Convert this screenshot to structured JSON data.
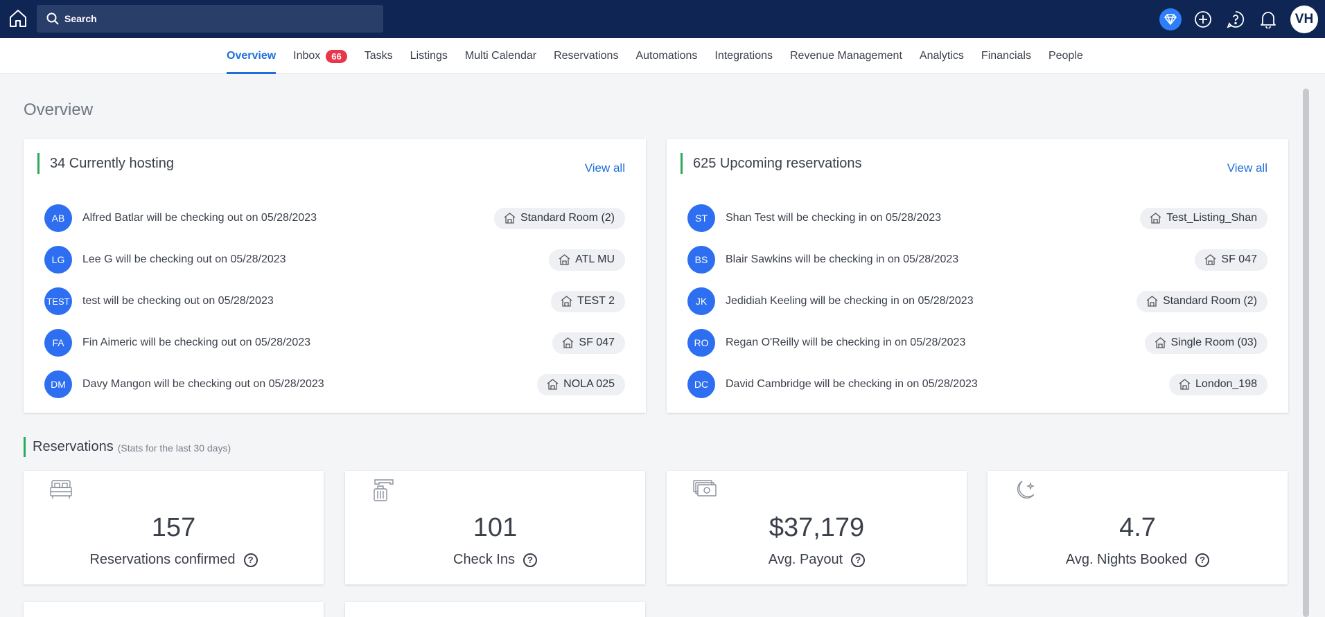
{
  "search": {
    "placeholder": "Search"
  },
  "user": {
    "initials": "VH"
  },
  "nav": {
    "items": [
      {
        "label": "Overview"
      },
      {
        "label": "Inbox",
        "badge": "66"
      },
      {
        "label": "Tasks"
      },
      {
        "label": "Listings"
      },
      {
        "label": "Multi Calendar"
      },
      {
        "label": "Reservations"
      },
      {
        "label": "Automations"
      },
      {
        "label": "Integrations"
      },
      {
        "label": "Revenue Management"
      },
      {
        "label": "Analytics"
      },
      {
        "label": "Financials"
      },
      {
        "label": "People"
      }
    ]
  },
  "page": {
    "title": "Overview"
  },
  "hosting": {
    "title": "34 Currently hosting",
    "view_all": "View all",
    "rows": [
      {
        "initials": "AB",
        "text": "Alfred Batlar will be checking out on 05/28/2023",
        "listing": "Standard Room (2)"
      },
      {
        "initials": "LG",
        "text": "Lee G will be checking out on 05/28/2023",
        "listing": "ATL MU"
      },
      {
        "initials": "TEST",
        "text": "test will be checking out on 05/28/2023",
        "listing": "TEST 2"
      },
      {
        "initials": "FA",
        "text": "Fin Aimeric will be checking out on 05/28/2023",
        "listing": "SF 047"
      },
      {
        "initials": "DM",
        "text": "Davy Mangon will be checking out on 05/28/2023",
        "listing": "NOLA 025"
      }
    ]
  },
  "upcoming": {
    "title": "625 Upcoming reservations",
    "view_all": "View all",
    "rows": [
      {
        "initials": "ST",
        "text": "Shan Test will be checking in on 05/28/2023",
        "listing": "Test_Listing_Shan"
      },
      {
        "initials": "BS",
        "text": "Blair Sawkins will be checking in on 05/28/2023",
        "listing": "SF 047"
      },
      {
        "initials": "JK",
        "text": "Jedidiah Keeling will be checking in on 05/28/2023",
        "listing": "Standard Room (2)"
      },
      {
        "initials": "RO",
        "text": "Regan O'Reilly will be checking in on 05/28/2023",
        "listing": "Single Room (03)"
      },
      {
        "initials": "DC",
        "text": "David Cambridge will be checking in on 05/28/2023",
        "listing": "London_198"
      }
    ]
  },
  "reservations": {
    "title": "Reservations",
    "subtitle": "(Stats for the last 30 days)",
    "stats": [
      {
        "icon": "bed-icon",
        "value": "157",
        "label": "Reservations confirmed"
      },
      {
        "icon": "luggage-icon",
        "value": "101",
        "label": "Check Ins"
      },
      {
        "icon": "money-icon",
        "value": "$37,179",
        "label": "Avg. Payout"
      },
      {
        "icon": "moon-icon",
        "value": "4.7",
        "label": "Avg. Nights Booked"
      }
    ]
  },
  "colors": {
    "topbar": "#0f2554",
    "accent": "#1e6fd9",
    "badge": "#e8364a",
    "section_bar": "#2ba95b",
    "avatar": "#2d6ff0"
  }
}
